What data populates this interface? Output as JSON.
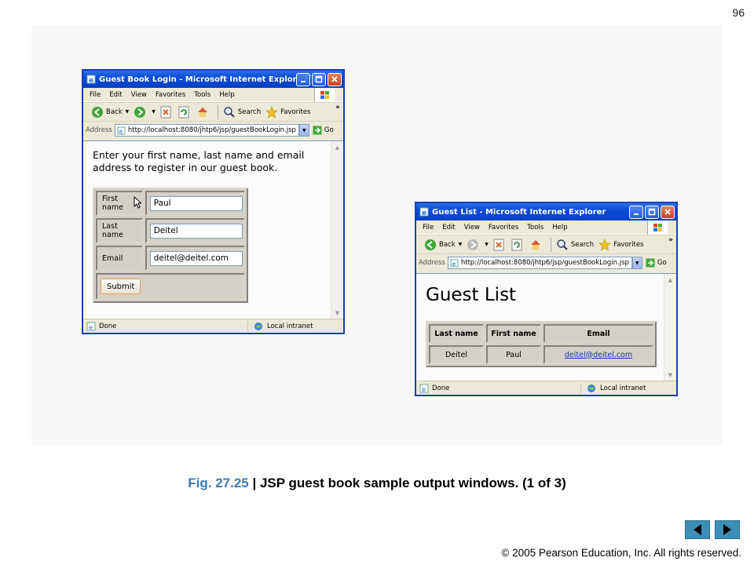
{
  "slide": {
    "page_number": "96",
    "caption_prefix": "Fig. 27.25",
    "caption_sep": " | ",
    "caption_text": "JSP guest book sample output windows. (1 of 3)",
    "copyright": "© 2005 Pearson Education, Inc.  All rights reserved.",
    "nav": {
      "prev": "previous-slide",
      "next": "next-slide"
    }
  },
  "browser": {
    "menu": [
      "File",
      "Edit",
      "View",
      "Favorites",
      "Tools",
      "Help"
    ],
    "back_label": "Back",
    "search_label": "Search",
    "favorites_label": "Favorites",
    "address_label": "Address",
    "go_label": "Go",
    "status_text": "Done",
    "zone_text": "Local intranet",
    "chevron": "»"
  },
  "login_window": {
    "title": "Guest Book Login - Microsoft Internet Explorer",
    "url": "http://localhost:8080/jhtp6/jsp/guestBookLogin.jsp",
    "intro_line1": "Enter your first name, last name and email",
    "intro_line2": "address to register in our guest book.",
    "fields": [
      {
        "label": "First name",
        "value": "Paul"
      },
      {
        "label": "Last name",
        "value": "Deitel"
      },
      {
        "label": "Email",
        "value": "deitel@deitel.com"
      }
    ],
    "submit_label": "Submit"
  },
  "list_window": {
    "title": "Guest List - Microsoft Internet Explorer",
    "url": "http://localhost:8080/jhtp6/jsp/guestBookLogin.jsp",
    "heading": "Guest List",
    "columns": [
      "Last name",
      "First name",
      "Email"
    ],
    "rows": [
      {
        "last": "Deitel",
        "first": "Paul",
        "email": "deitel@deitel.com"
      }
    ]
  },
  "colors": {
    "caption_fig": "#3c7bb9",
    "titlebar": "#0a4bd6",
    "nav_button": "#3d8fb8"
  }
}
